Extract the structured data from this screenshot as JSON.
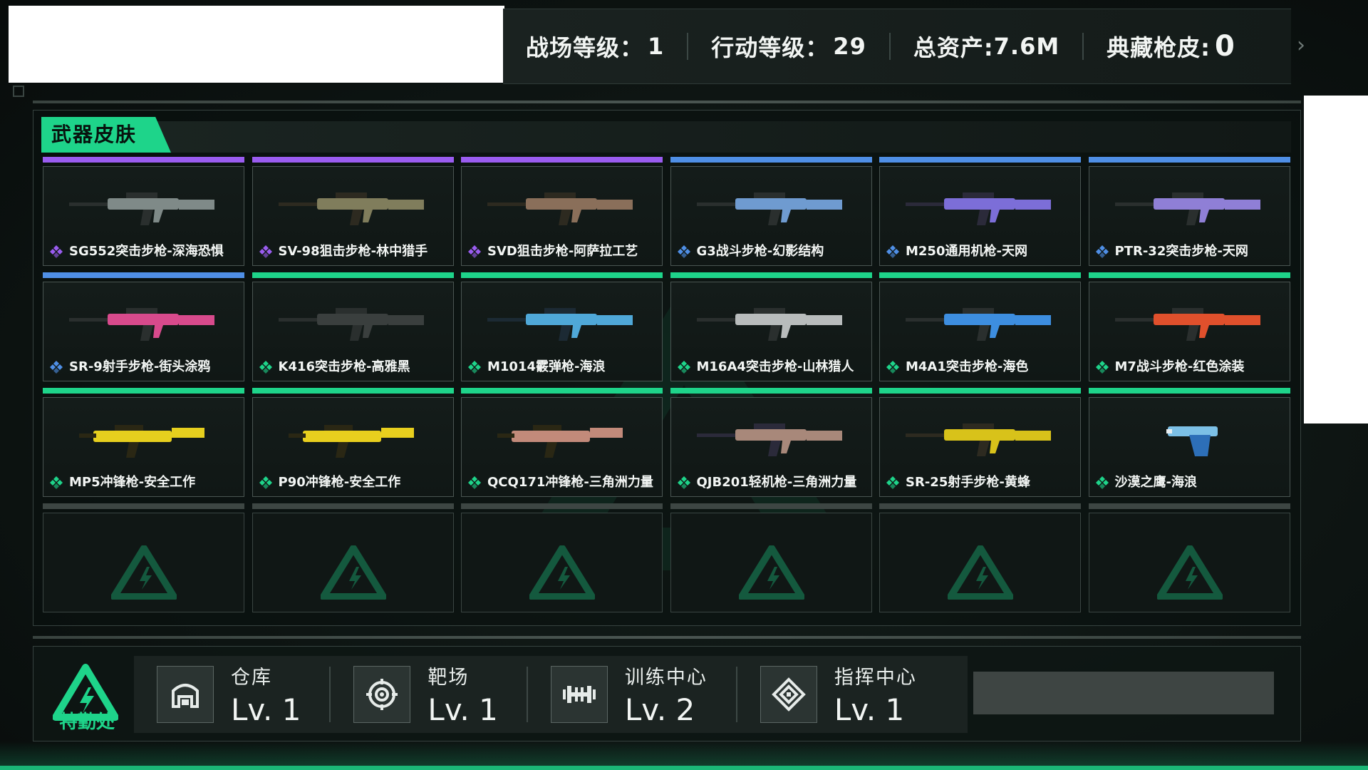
{
  "header": {
    "stats": [
      {
        "label": "战场等级：",
        "value": "1"
      },
      {
        "label": "行动等级：",
        "value": "29"
      },
      {
        "label": "总资产:",
        "value": "7.6M"
      },
      {
        "label": "典藏枪皮:",
        "value": "0"
      }
    ]
  },
  "section": {
    "title": "武器皮肤"
  },
  "colors": {
    "accent": "#1ed48a",
    "purple": "#9a5cf0",
    "blue": "#4f8fe6",
    "green": "#1ed48a"
  },
  "skins": [
    {
      "name": "SG552突击步枪-深海恐惧",
      "rarity": "purple",
      "icon": "rifle-icon"
    },
    {
      "name": "SV-98狙击步枪-林中猎手",
      "rarity": "purple",
      "icon": "sniper-icon"
    },
    {
      "name": "SVD狙击步枪-阿萨拉工艺",
      "rarity": "purple",
      "icon": "sniper-icon"
    },
    {
      "name": "G3战斗步枪-幻影结构",
      "rarity": "blue",
      "icon": "rifle-icon"
    },
    {
      "name": "M250通用机枪-天网",
      "rarity": "blue",
      "icon": "machine-gun-icon"
    },
    {
      "name": "PTR-32突击步枪-天网",
      "rarity": "blue",
      "icon": "rifle-icon"
    },
    {
      "name": "SR-9射手步枪-街头涂鸦",
      "rarity": "blue",
      "icon": "rifle-icon"
    },
    {
      "name": "K416突击步枪-高雅黑",
      "rarity": "green",
      "icon": "rifle-icon"
    },
    {
      "name": "M1014霰弹枪-海浪",
      "rarity": "green",
      "icon": "shotgun-icon"
    },
    {
      "name": "M16A4突击步枪-山林猎人",
      "rarity": "green",
      "icon": "rifle-icon"
    },
    {
      "name": "M4A1突击步枪-海色",
      "rarity": "green",
      "icon": "rifle-icon"
    },
    {
      "name": "M7战斗步枪-红色涂装",
      "rarity": "green",
      "icon": "rifle-icon"
    },
    {
      "name": "MP5冲锋枪-安全工作",
      "rarity": "green",
      "icon": "smg-icon"
    },
    {
      "name": "P90冲锋枪-安全工作",
      "rarity": "green",
      "icon": "smg-icon"
    },
    {
      "name": "QCQ171冲锋枪-三角洲力量",
      "rarity": "green",
      "icon": "smg-icon"
    },
    {
      "name": "QJB201轻机枪-三角洲力量",
      "rarity": "green",
      "icon": "machine-gun-icon"
    },
    {
      "name": "SR-25射手步枪-黄蜂",
      "rarity": "green",
      "icon": "sniper-icon"
    },
    {
      "name": "沙漠之鹰-海浪",
      "rarity": "green",
      "icon": "pistol-icon"
    }
  ],
  "empty_slots": 6,
  "footer": {
    "logo_text": "特勤处",
    "facilities": [
      {
        "name": "仓库",
        "level": "Lv. 1",
        "icon": "warehouse-icon"
      },
      {
        "name": "靶场",
        "level": "Lv. 1",
        "icon": "target-icon"
      },
      {
        "name": "训练中心",
        "level": "Lv. 2",
        "icon": "dumbbell-icon"
      },
      {
        "name": "指挥中心",
        "level": "Lv. 1",
        "icon": "command-icon"
      }
    ]
  }
}
